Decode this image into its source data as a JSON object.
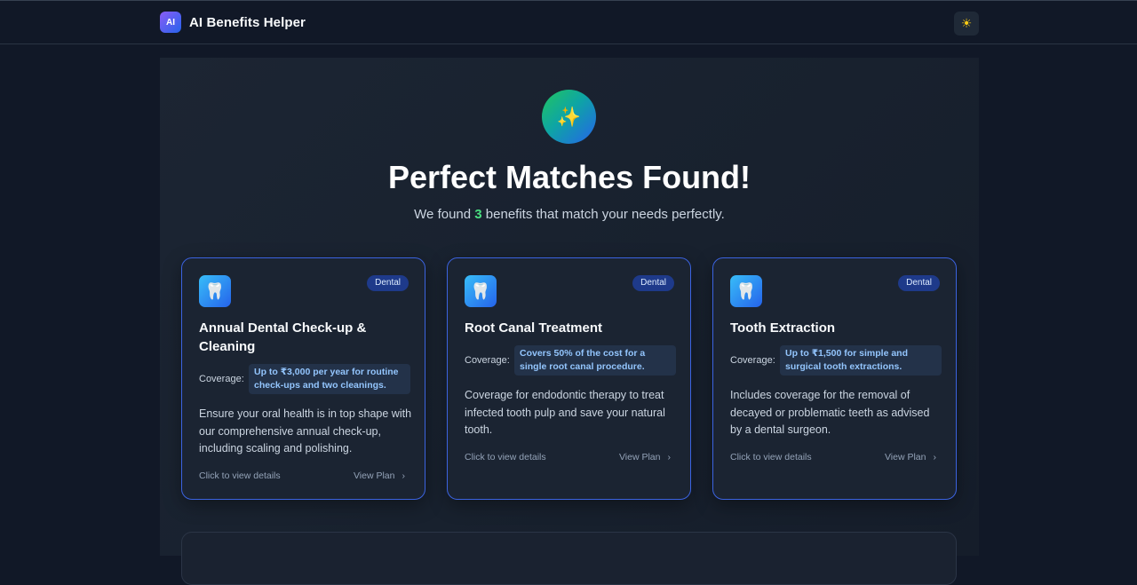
{
  "header": {
    "logo_text": "AI",
    "title": "AI Benefits Helper",
    "theme_icon": "☀"
  },
  "hero": {
    "icon": "✨",
    "title": "Perfect Matches Found!",
    "subtitle_prefix": "We found ",
    "count": "3",
    "subtitle_suffix": " benefits that match your needs perfectly."
  },
  "cards": [
    {
      "icon": "🦷",
      "badge": "Dental",
      "title": "Annual Dental Check-up & Cleaning",
      "coverage_label": "Coverage:",
      "coverage": "Up to ₹3,000 per year for routine check-ups and two cleanings.",
      "description": "Ensure your oral health is in top shape with our comprehensive annual check-up, including scaling and polishing.",
      "footer_left": "Click to view details",
      "footer_right": "View Plan"
    },
    {
      "icon": "🦷",
      "badge": "Dental",
      "title": "Root Canal Treatment",
      "coverage_label": "Coverage:",
      "coverage": "Covers 50% of the cost for a single root canal procedure.",
      "description": "Coverage for endodontic therapy to treat infected tooth pulp and save your natural tooth.",
      "footer_left": "Click to view details",
      "footer_right": "View Plan"
    },
    {
      "icon": "🦷",
      "badge": "Dental",
      "title": "Tooth Extraction",
      "coverage_label": "Coverage:",
      "coverage": "Up to ₹1,500 for simple and surgical tooth extractions.",
      "description": "Includes coverage for the removal of decayed or problematic teeth as advised by a dental surgeon.",
      "footer_left": "Click to view details",
      "footer_right": "View Plan"
    }
  ]
}
